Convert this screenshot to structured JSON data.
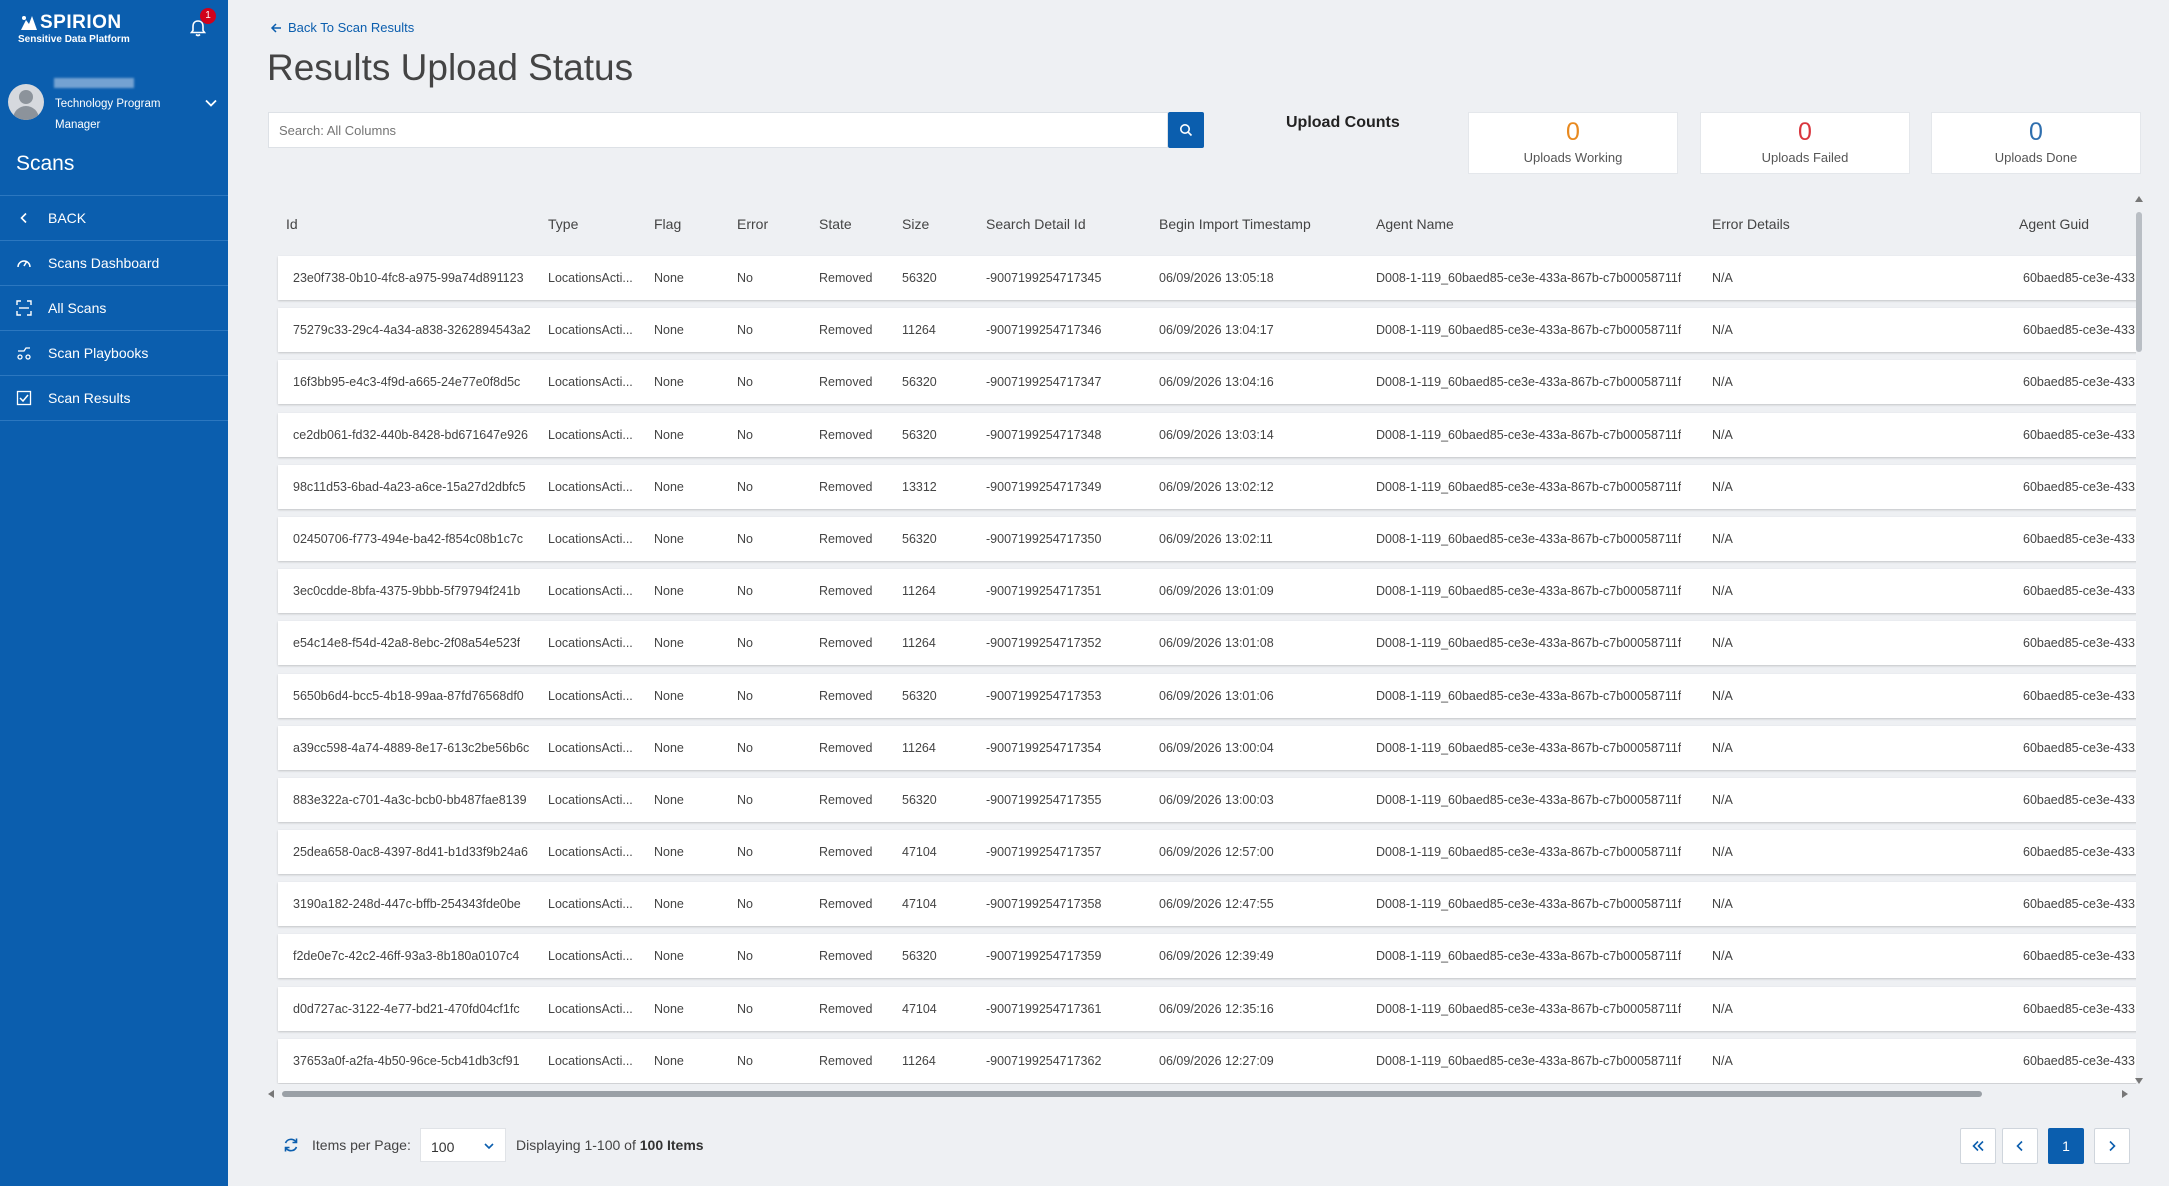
{
  "brand": {
    "name": "SPIRION",
    "tagline": "Sensitive Data Platform"
  },
  "notifications": {
    "count": "1"
  },
  "user": {
    "role": "Technology Program Manager"
  },
  "sidebar": {
    "section_title": "Scans",
    "items": [
      {
        "label": "BACK",
        "icon": "chevron-left-icon"
      },
      {
        "label": "Scans Dashboard",
        "icon": "gauge-icon"
      },
      {
        "label": "All Scans",
        "icon": "scan-icon"
      },
      {
        "label": "Scan Playbooks",
        "icon": "playbook-icon"
      },
      {
        "label": "Scan Results",
        "icon": "checklist-icon"
      }
    ]
  },
  "breadcrumb": {
    "back_label": "Back To Scan Results"
  },
  "page": {
    "title": "Results Upload Status"
  },
  "search": {
    "placeholder": "Search: All Columns"
  },
  "upload_counts": {
    "label": "Upload Counts",
    "working": {
      "value": "0",
      "label": "Uploads Working",
      "color": "#e8891f"
    },
    "failed": {
      "value": "0",
      "label": "Uploads Failed",
      "color": "#d9363e"
    },
    "done": {
      "value": "0",
      "label": "Uploads Done",
      "color": "#2f6fae"
    }
  },
  "table": {
    "columns": [
      "Id",
      "Type",
      "Flag",
      "Error",
      "State",
      "Size",
      "Search Detail Id",
      "Begin Import Timestamp",
      "Agent Name",
      "Error Details",
      "Agent Guid"
    ],
    "rows": [
      [
        "23e0f738-0b10-4fc8-a975-99a74d891123",
        "LocationsActi...",
        "None",
        "No",
        "Removed",
        "56320",
        "-9007199254717345",
        "06/09/2026 13:05:18",
        "D008-1-119_60baed85-ce3e-433a-867b-c7b00058711f",
        "N/A",
        "60baed85-ce3e-433"
      ],
      [
        "75279c33-29c4-4a34-a838-3262894543a2",
        "LocationsActi...",
        "None",
        "No",
        "Removed",
        "11264",
        "-9007199254717346",
        "06/09/2026 13:04:17",
        "D008-1-119_60baed85-ce3e-433a-867b-c7b00058711f",
        "N/A",
        "60baed85-ce3e-433"
      ],
      [
        "16f3bb95-e4c3-4f9d-a665-24e77e0f8d5c",
        "LocationsActi...",
        "None",
        "No",
        "Removed",
        "56320",
        "-9007199254717347",
        "06/09/2026 13:04:16",
        "D008-1-119_60baed85-ce3e-433a-867b-c7b00058711f",
        "N/A",
        "60baed85-ce3e-433"
      ],
      [
        "ce2db061-fd32-440b-8428-bd671647e926",
        "LocationsActi...",
        "None",
        "No",
        "Removed",
        "56320",
        "-9007199254717348",
        "06/09/2026 13:03:14",
        "D008-1-119_60baed85-ce3e-433a-867b-c7b00058711f",
        "N/A",
        "60baed85-ce3e-433"
      ],
      [
        "98c11d53-6bad-4a23-a6ce-15a27d2dbfc5",
        "LocationsActi...",
        "None",
        "No",
        "Removed",
        "13312",
        "-9007199254717349",
        "06/09/2026 13:02:12",
        "D008-1-119_60baed85-ce3e-433a-867b-c7b00058711f",
        "N/A",
        "60baed85-ce3e-433"
      ],
      [
        "02450706-f773-494e-ba42-f854c08b1c7c",
        "LocationsActi...",
        "None",
        "No",
        "Removed",
        "56320",
        "-9007199254717350",
        "06/09/2026 13:02:11",
        "D008-1-119_60baed85-ce3e-433a-867b-c7b00058711f",
        "N/A",
        "60baed85-ce3e-433"
      ],
      [
        "3ec0cdde-8bfa-4375-9bbb-5f79794f241b",
        "LocationsActi...",
        "None",
        "No",
        "Removed",
        "11264",
        "-9007199254717351",
        "06/09/2026 13:01:09",
        "D008-1-119_60baed85-ce3e-433a-867b-c7b00058711f",
        "N/A",
        "60baed85-ce3e-433"
      ],
      [
        "e54c14e8-f54d-42a8-8ebc-2f08a54e523f",
        "LocationsActi...",
        "None",
        "No",
        "Removed",
        "11264",
        "-9007199254717352",
        "06/09/2026 13:01:08",
        "D008-1-119_60baed85-ce3e-433a-867b-c7b00058711f",
        "N/A",
        "60baed85-ce3e-433"
      ],
      [
        "5650b6d4-bcc5-4b18-99aa-87fd76568df0",
        "LocationsActi...",
        "None",
        "No",
        "Removed",
        "56320",
        "-9007199254717353",
        "06/09/2026 13:01:06",
        "D008-1-119_60baed85-ce3e-433a-867b-c7b00058711f",
        "N/A",
        "60baed85-ce3e-433"
      ],
      [
        "a39cc598-4a74-4889-8e17-613c2be56b6c",
        "LocationsActi...",
        "None",
        "No",
        "Removed",
        "11264",
        "-9007199254717354",
        "06/09/2026 13:00:04",
        "D008-1-119_60baed85-ce3e-433a-867b-c7b00058711f",
        "N/A",
        "60baed85-ce3e-433"
      ],
      [
        "883e322a-c701-4a3c-bcb0-bb487fae8139",
        "LocationsActi...",
        "None",
        "No",
        "Removed",
        "56320",
        "-9007199254717355",
        "06/09/2026 13:00:03",
        "D008-1-119_60baed85-ce3e-433a-867b-c7b00058711f",
        "N/A",
        "60baed85-ce3e-433"
      ],
      [
        "25dea658-0ac8-4397-8d41-b1d33f9b24a6",
        "LocationsActi...",
        "None",
        "No",
        "Removed",
        "47104",
        "-9007199254717357",
        "06/09/2026 12:57:00",
        "D008-1-119_60baed85-ce3e-433a-867b-c7b00058711f",
        "N/A",
        "60baed85-ce3e-433"
      ],
      [
        "3190a182-248d-447c-bffb-254343fde0be",
        "LocationsActi...",
        "None",
        "No",
        "Removed",
        "47104",
        "-9007199254717358",
        "06/09/2026 12:47:55",
        "D008-1-119_60baed85-ce3e-433a-867b-c7b00058711f",
        "N/A",
        "60baed85-ce3e-433"
      ],
      [
        "f2de0e7c-42c2-46ff-93a3-8b180a0107c4",
        "LocationsActi...",
        "None",
        "No",
        "Removed",
        "56320",
        "-9007199254717359",
        "06/09/2026 12:39:49",
        "D008-1-119_60baed85-ce3e-433a-867b-c7b00058711f",
        "N/A",
        "60baed85-ce3e-433"
      ],
      [
        "d0d727ac-3122-4e77-bd21-470fd04cf1fc",
        "LocationsActi...",
        "None",
        "No",
        "Removed",
        "47104",
        "-9007199254717361",
        "06/09/2026 12:35:16",
        "D008-1-119_60baed85-ce3e-433a-867b-c7b00058711f",
        "N/A",
        "60baed85-ce3e-433"
      ],
      [
        "37653a0f-a2fa-4b50-96ce-5cb41db3cf91",
        "LocationsActi...",
        "None",
        "No",
        "Removed",
        "11264",
        "-9007199254717362",
        "06/09/2026 12:27:09",
        "D008-1-119_60baed85-ce3e-433a-867b-c7b00058711f",
        "N/A",
        "60baed85-ce3e-433"
      ]
    ]
  },
  "pagination": {
    "items_per_page_label": "Items per Page:",
    "items_per_page": "100",
    "displaying_prefix": "Displaying 1-100 of",
    "displaying_total": "100 Items",
    "current_page": "1"
  }
}
